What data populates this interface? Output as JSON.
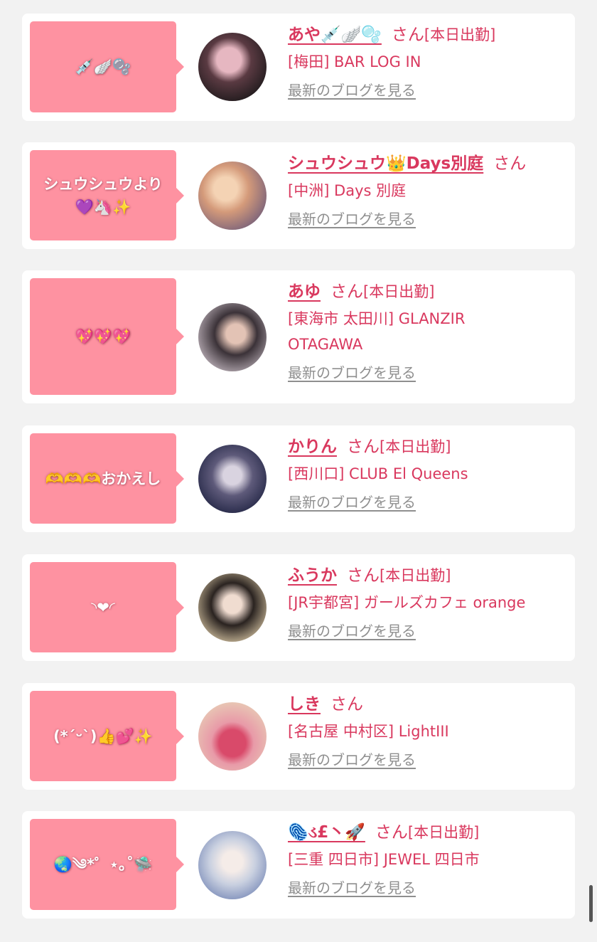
{
  "entries": [
    {
      "bubble_text": "💉🪽🫧",
      "name": "あや💉🪽🫧",
      "suffix": "さん",
      "status": "[本日出勤]",
      "shop": "[梅田] BAR LOG IN",
      "blog_link": "最新のブログを見る",
      "avatar_colors": [
        "#3a2a2e",
        "#c98fa0"
      ]
    },
    {
      "bubble_text": "シュウシュウより💜🦄✨",
      "name": "シュウシュウ👑Days別庭",
      "suffix": "さん",
      "status": "",
      "shop": "[中洲] Days 別庭",
      "blog_link": "最新のブログを見る",
      "avatar_colors": [
        "#e8b08a",
        "#6d5a7a"
      ]
    },
    {
      "bubble_text": "💖💖💖",
      "name": "あゆ",
      "suffix": "さん",
      "status": "[本日出勤]",
      "shop": "[東海市 太田川] GLANZIR OTAGAWA",
      "blog_link": "最新のブログを見る",
      "avatar_colors": [
        "#c9c2c8",
        "#3b3238"
      ]
    },
    {
      "bubble_text": "🫶🫶🫶おかえし",
      "name": "かりん",
      "suffix": "さん",
      "status": "[本日出勤]",
      "shop": "[西川口] CLUB El Queens",
      "blog_link": "最新のブログを見る",
      "avatar_colors": [
        "#1d2140",
        "#a8a6c2"
      ]
    },
    {
      "bubble_text": "◝❤︎◜",
      "name": "ふうか",
      "suffix": "さん",
      "status": "[本日出勤]",
      "shop": "[JR宇都宮] ガールズカフェ orange",
      "blog_link": "最新のブログを見る",
      "avatar_colors": [
        "#d9c7a5",
        "#2a2320"
      ]
    },
    {
      "bubble_text": "(*´ᵕ`)👍💕✨",
      "name": "しき",
      "suffix": "さん",
      "status": "",
      "shop": "[名古屋 中村区] LightIII",
      "blog_link": "最新のブログを見る",
      "avatar_colors": [
        "#e8c9b5",
        "#d94a6a"
      ]
    },
    {
      "bubble_text": "🌏༄*゜⋆｡˚🛸",
      "name": "🫆ડ£丶🚀",
      "suffix": "さん",
      "status": "[本日出勤]",
      "shop": "[三重 四日市] JEWEL 四日市",
      "blog_link": "最新のブログを見る",
      "avatar_colors": [
        "#e9ecf2",
        "#6a7db0"
      ]
    }
  ]
}
